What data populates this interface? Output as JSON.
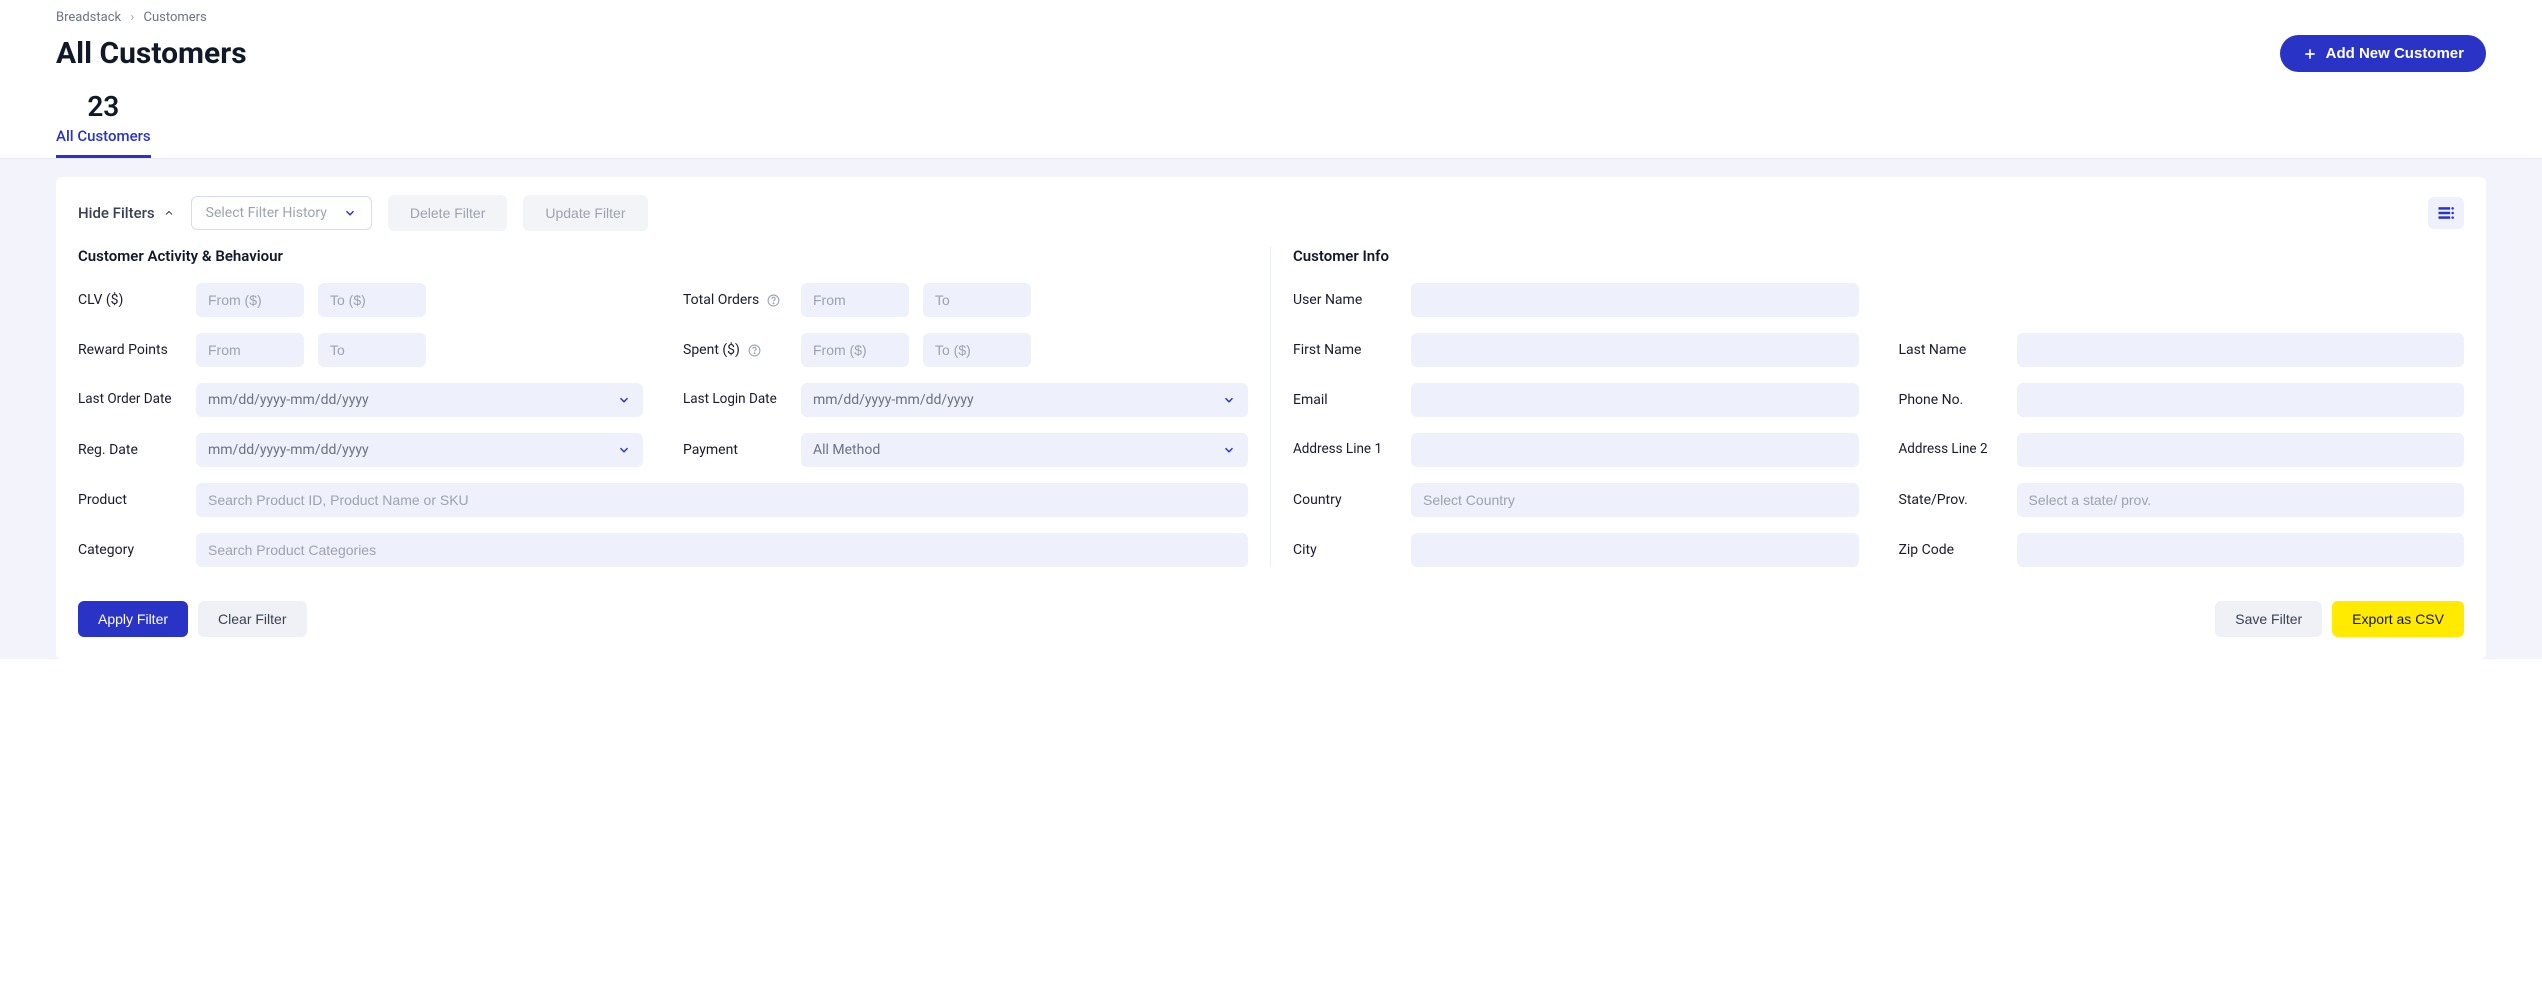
{
  "breadcrumb": {
    "root": "Breadstack",
    "current": "Customers"
  },
  "page_title": "All Customers",
  "add_button": "Add New Customer",
  "tab": {
    "count": "23",
    "label": "All Customers"
  },
  "filters": {
    "hide_label": "Hide Filters",
    "select_history_placeholder": "Select Filter History",
    "delete_btn": "Delete Filter",
    "update_btn": "Update Filter",
    "left": {
      "heading": "Customer Activity & Behaviour",
      "clv_label": "CLV ($)",
      "clv_from_ph": "From ($)",
      "clv_to_ph": "To ($)",
      "total_orders_label": "Total Orders",
      "total_from_ph": "From",
      "total_to_ph": "To",
      "reward_label": "Reward Points",
      "reward_from_ph": "From",
      "reward_to_ph": "To",
      "spent_label": "Spent ($)",
      "spent_from_ph": "From ($)",
      "spent_to_ph": "To ($)",
      "last_order_label": "Last Order Date",
      "last_login_label": "Last Login Date",
      "date_ph": "mm/dd/yyyy-mm/dd/yyyy",
      "reg_date_label": "Reg. Date",
      "payment_label": "Payment",
      "payment_ph": "All Method",
      "product_label": "Product",
      "product_ph": "Search Product ID, Product Name or SKU",
      "category_label": "Category",
      "category_ph": "Search Product Categories"
    },
    "right": {
      "heading": "Customer Info",
      "username_label": "User Name",
      "firstname_label": "First Name",
      "lastname_label": "Last Name",
      "email_label": "Email",
      "phone_label": "Phone No.",
      "addr1_label": "Address Line 1",
      "addr2_label": "Address Line 2",
      "country_label": "Country",
      "country_ph": "Select Country",
      "state_label": "State/Prov.",
      "state_ph": "Select a state/ prov.",
      "city_label": "City",
      "zip_label": "Zip Code"
    }
  },
  "actions": {
    "apply": "Apply Filter",
    "clear": "Clear Filter",
    "save": "Save Filter",
    "export": "Export as CSV"
  }
}
